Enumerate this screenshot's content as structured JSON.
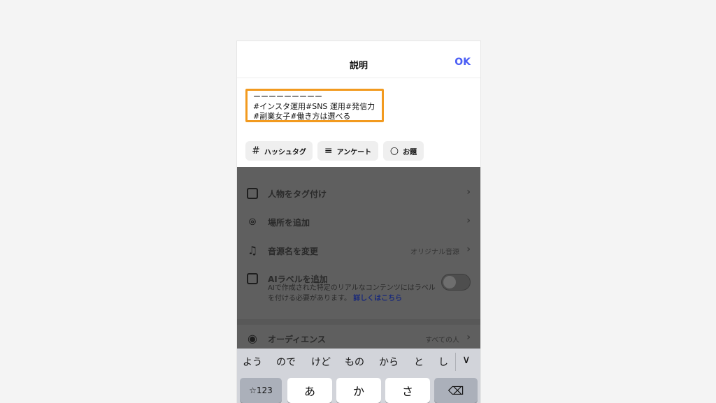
{
  "header": {
    "title": "説明",
    "ok_label": "OK"
  },
  "caption": {
    "lines": [
      "ーーーーーーーーー",
      "#インスタ運用#SNS 運用#発信力",
      "#副業女子#働き方は選べる"
    ]
  },
  "chips": [
    {
      "icon": "#",
      "label": "ハッシュタグ"
    },
    {
      "icon": "≡",
      "label": "アンケート"
    },
    {
      "icon": "○",
      "label": "お題"
    }
  ],
  "menu": {
    "tag_people": "人物をタグ付け",
    "add_location": "場所を追加",
    "rename_audio": "音源名を変更",
    "rename_audio_value": "オリジナル音源",
    "ai_label": "AIラベルを追加",
    "ai_desc": "AIで作成された特定のリアルなコンテンツにはラベルを付ける必要があります。",
    "ai_link": "詳しくはこちら",
    "audience": "オーディエンス",
    "audience_value": "すべての人"
  },
  "keyboard": {
    "suggestions": [
      "よう",
      "ので",
      "けど",
      "もの",
      "から",
      "と",
      "し"
    ],
    "keys": [
      "☆123",
      "あ",
      "か",
      "さ",
      "⌫"
    ]
  },
  "colors": {
    "accent": "#4a5df5",
    "highlight": "#f29a1f",
    "overlay": "#5f5f5f",
    "keyboard": "#d2d4da"
  }
}
